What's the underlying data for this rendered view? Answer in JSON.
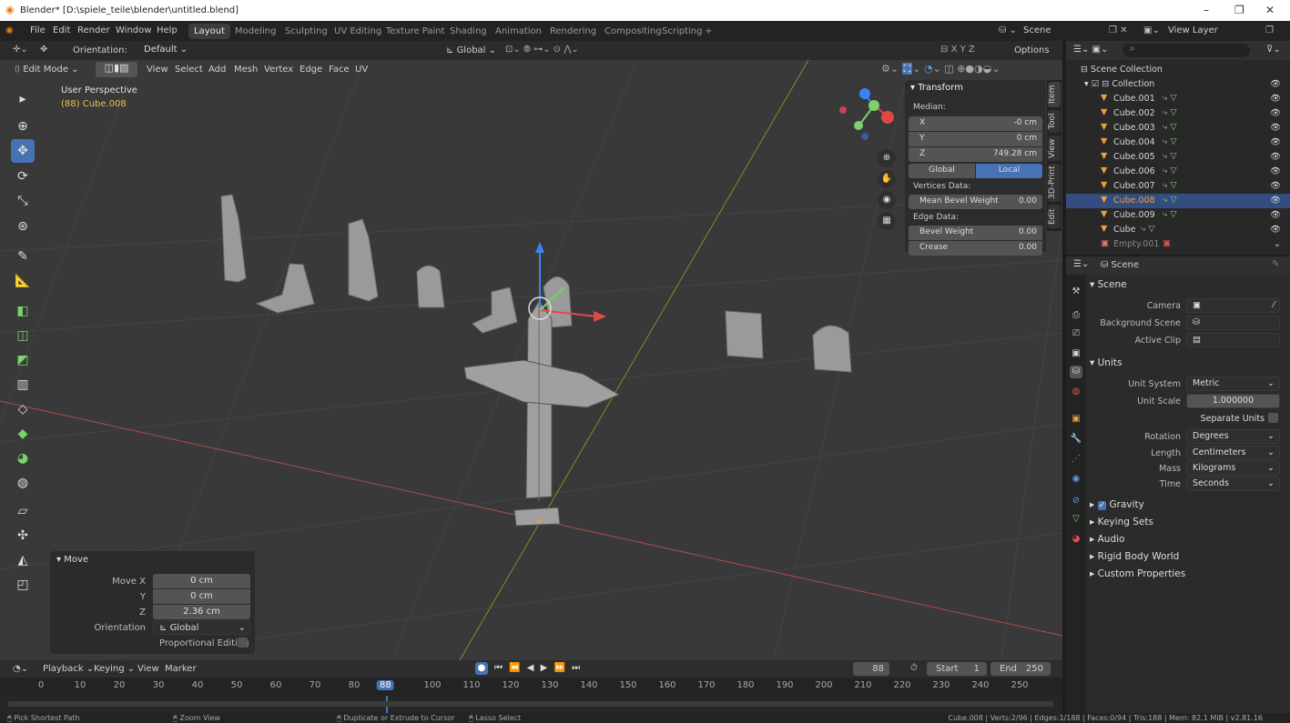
{
  "window": {
    "title": "Blender* [D:\\spiele_teile\\blender\\untitled.blend]",
    "minimize": "–",
    "maximize": "❐",
    "close": "✕"
  },
  "menu": [
    "File",
    "Edit",
    "Render",
    "Window",
    "Help"
  ],
  "workspaces": [
    "Layout",
    "Modeling",
    "Sculpting",
    "UV Editing",
    "Texture Paint",
    "Shading",
    "Animation",
    "Rendering",
    "Compositing",
    "Scripting",
    "+"
  ],
  "scene_name": "Scene",
  "view_layer": "View Layer",
  "toolheader": {
    "orientation_label": "Orientation:",
    "orientation_value": "Default",
    "transform_orient": "Global",
    "options": "Options",
    "xyz": [
      "X",
      "Y",
      "Z"
    ]
  },
  "viewport_header": {
    "mode": "Edit Mode",
    "menus": [
      "View",
      "Select",
      "Add",
      "Mesh",
      "Vertex",
      "Edge",
      "Face",
      "UV"
    ]
  },
  "viewport": {
    "perspective": "User Perspective",
    "object": "(88) Cube.008"
  },
  "npanel": {
    "header": "Transform",
    "median_label": "Median:",
    "x_label": "X",
    "x_value": "-0 cm",
    "y_label": "Y",
    "y_value": "0 cm",
    "z_label": "Z",
    "z_value": "749.28 cm",
    "global": "Global",
    "local": "Local",
    "vertices_data": "Vertices Data:",
    "mean_bevel": "Mean Bevel Weight",
    "mean_bevel_value": "0.00",
    "edge_data": "Edge Data:",
    "bevel_weight": "Bevel Weight",
    "bevel_weight_value": "0.00",
    "crease": "Crease",
    "crease_value": "0.00",
    "tabs": [
      "Item",
      "Tool",
      "View",
      "3D-Print",
      "Edit"
    ]
  },
  "move_panel": {
    "title": "Move",
    "move_x_label": "Move X",
    "move_x": "0 cm",
    "y_label": "Y",
    "y": "0 cm",
    "z_label": "Z",
    "z": "2.36 cm",
    "orientation_label": "Orientation",
    "orientation": "Global",
    "proportional": "Proportional Editing"
  },
  "timeline": {
    "menus": [
      "Playback",
      "Keying",
      "View",
      "Marker"
    ],
    "current_frame": "88",
    "start_label": "Start",
    "start": "1",
    "end_label": "End",
    "end": "250",
    "ticks": [
      "0",
      "10",
      "20",
      "30",
      "40",
      "50",
      "60",
      "70",
      "80",
      "88",
      "100",
      "110",
      "120",
      "130",
      "140",
      "150",
      "160",
      "170",
      "180",
      "190",
      "200",
      "210",
      "220",
      "230",
      "240",
      "250"
    ]
  },
  "status": {
    "pick": "Pick Shortest Path",
    "zoom": "Zoom View",
    "duplicate": "Duplicate or Extrude to Cursor",
    "lasso": "Lasso Select",
    "info": "Cube.008 | Verts:2/96 | Edges:1/188 | Faces:0/94 | Tris:188 | Mem: 82.1 MiB | v2.81.16"
  },
  "outliner": {
    "root": "Scene Collection",
    "collection": "Collection",
    "items": [
      "Cube.001",
      "Cube.002",
      "Cube.003",
      "Cube.004",
      "Cube.005",
      "Cube.006",
      "Cube.007",
      "Cube.008",
      "Cube.009",
      "Cube",
      "Empty.001"
    ],
    "selected": "Cube.008"
  },
  "properties": {
    "context": "Scene",
    "section_scene": "Scene",
    "camera_label": "Camera",
    "background_label": "Background Scene",
    "clip_label": "Active Clip",
    "section_units": "Units",
    "unit_system_label": "Unit System",
    "unit_system": "Metric",
    "unit_scale_label": "Unit Scale",
    "unit_scale": "1.000000",
    "separate_units": "Separate Units",
    "rotation_label": "Rotation",
    "rotation": "Degrees",
    "length_label": "Length",
    "length": "Centimeters",
    "mass_label": "Mass",
    "mass": "Kilograms",
    "time_label": "Time",
    "time": "Seconds",
    "gravity": "Gravity",
    "keying_sets": "Keying Sets",
    "audio": "Audio",
    "rigid_body": "Rigid Body World",
    "custom_props": "Custom Properties"
  },
  "colors": {
    "accent": "#4772b3",
    "selected_row": "#334d80",
    "object_orange": "#e8a03c",
    "mesh_green": "#7bd16d"
  }
}
